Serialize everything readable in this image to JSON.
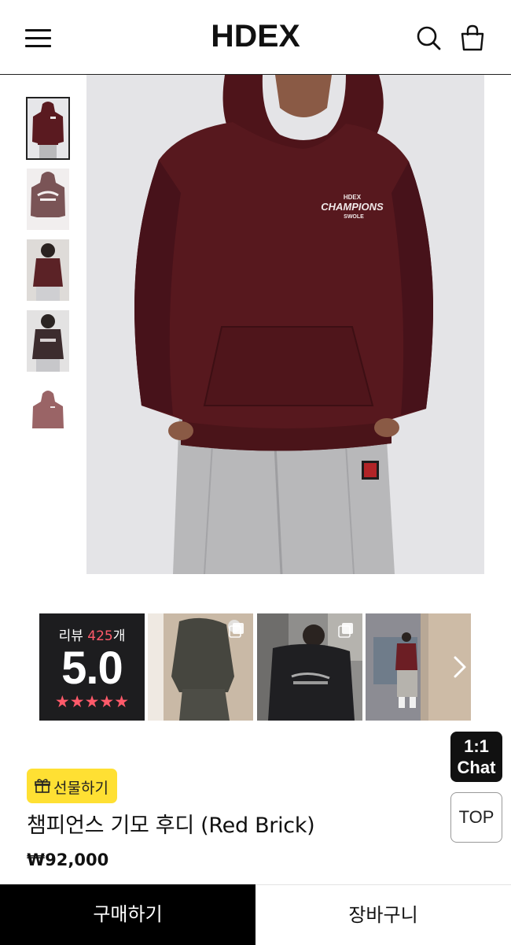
{
  "header": {
    "logo": "HDEX",
    "menu_icon": "hamburger-menu-icon",
    "search_icon": "search-icon",
    "cart_icon": "shopping-bag-icon"
  },
  "gallery": {
    "thumbnails": [
      {
        "label": "thumbnail-1",
        "active": true
      },
      {
        "label": "thumbnail-2",
        "active": false
      },
      {
        "label": "thumbnail-3",
        "active": false
      },
      {
        "label": "thumbnail-4",
        "active": false
      },
      {
        "label": "thumbnail-5",
        "active": false
      }
    ],
    "main_graphic_text": {
      "top": "HDEX",
      "middle": "CHAMPIONS",
      "bottom": "SWOLE"
    }
  },
  "reviews": {
    "count_prefix": "리뷰 ",
    "count": "425",
    "count_suffix": "개",
    "score": "5.0",
    "stars": "★★★★★",
    "next_icon": "chevron-right-icon",
    "photo_icon": "multiple-photos-icon"
  },
  "floating": {
    "chat_line1": "1:1",
    "chat_line2": "Chat",
    "top_label": "TOP"
  },
  "product": {
    "gift_label": "선물하기",
    "gift_icon": "gift-icon",
    "title": "챔피언스 기모 후디 (Red Brick)",
    "price": "₩92,000"
  },
  "bottom_bar": {
    "buy_label": "구매하기",
    "cart_label": "장바구니"
  },
  "colors": {
    "hoodie": "#5a1a20",
    "background": "#e5e5e8",
    "gift_yellow": "#ffe033",
    "review_accent": "#ff5a6a",
    "buy_button": "#000000"
  }
}
